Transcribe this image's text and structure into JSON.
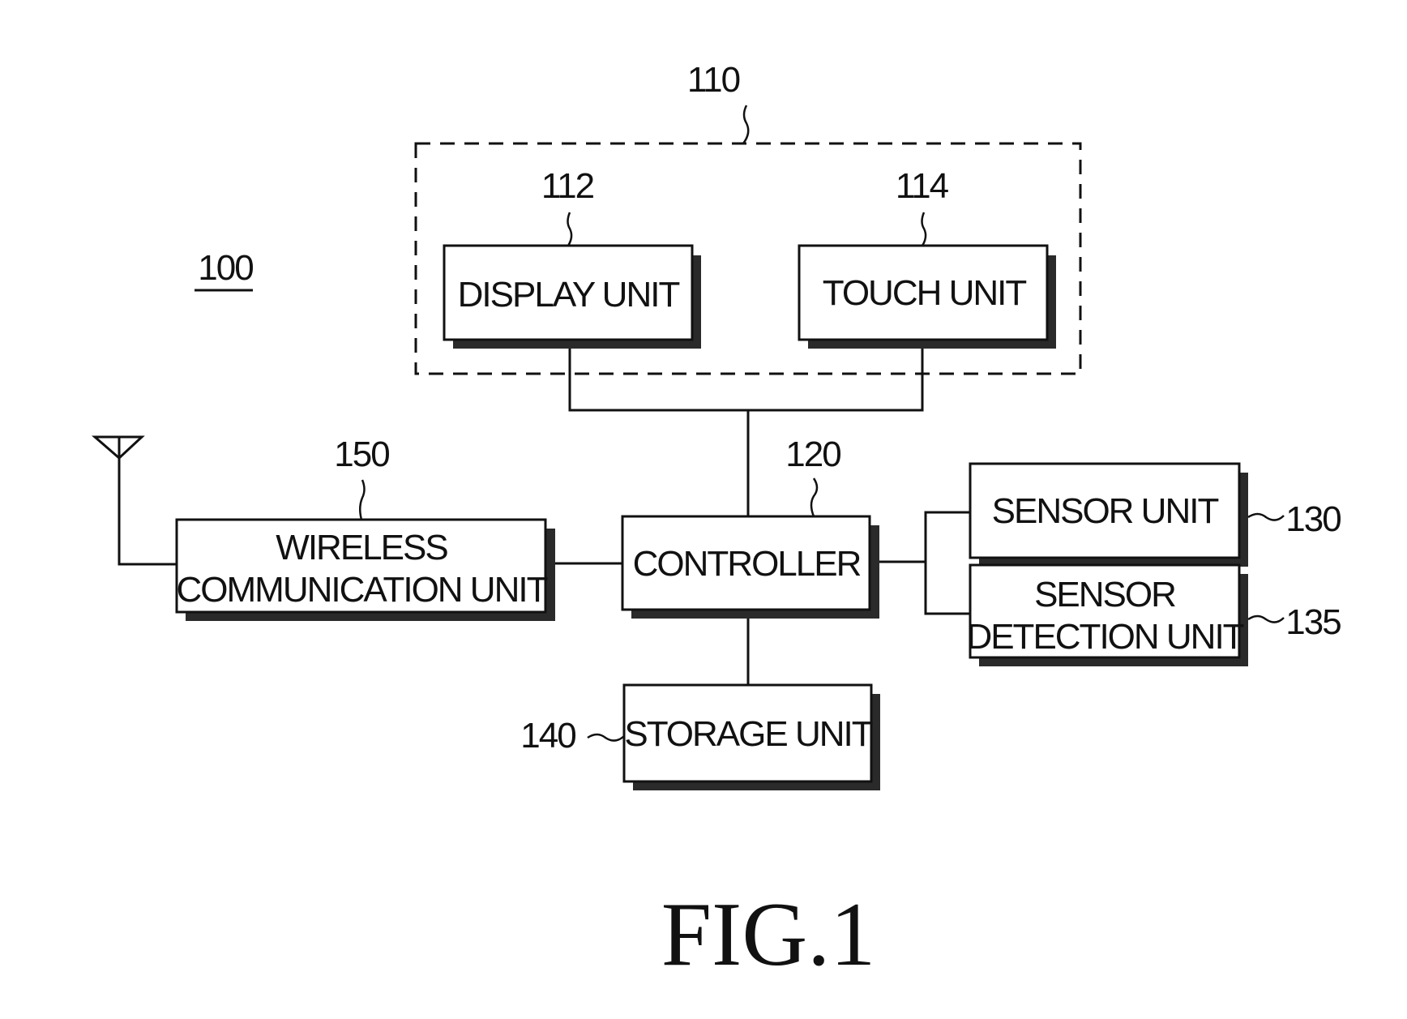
{
  "figure": {
    "caption": "FIG.1",
    "device_ref": "100"
  },
  "group": {
    "ref": "110"
  },
  "blocks": {
    "display": {
      "ref": "112",
      "lines": [
        "DISPLAY UNIT"
      ]
    },
    "touch": {
      "ref": "114",
      "lines": [
        "TOUCH UNIT"
      ]
    },
    "controller": {
      "ref": "120",
      "lines": [
        "CONTROLLER"
      ]
    },
    "sensor": {
      "ref": "130",
      "lines": [
        "SENSOR UNIT"
      ]
    },
    "sensor_detection": {
      "ref": "135",
      "lines": [
        "SENSOR",
        "DETECTION UNIT"
      ]
    },
    "storage": {
      "ref": "140",
      "lines": [
        "STORAGE UNIT"
      ]
    },
    "wireless": {
      "ref": "150",
      "lines": [
        "WIRELESS",
        "COMMUNICATION UNIT"
      ]
    }
  },
  "icons": {
    "antenna": "antenna-icon"
  }
}
